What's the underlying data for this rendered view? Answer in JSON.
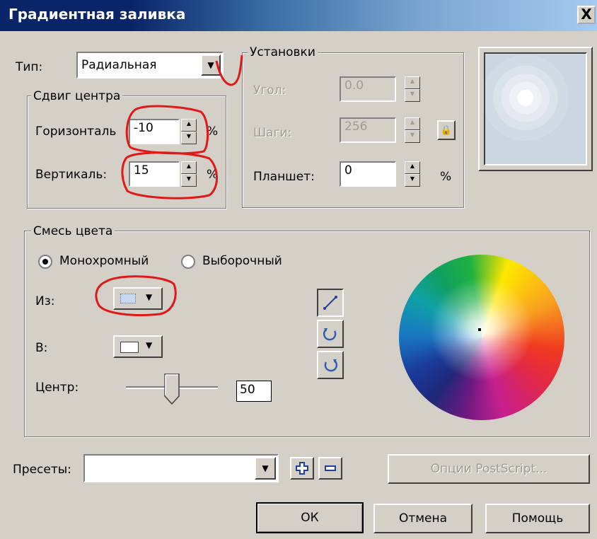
{
  "window": {
    "title": "Градиентная заливка",
    "close_label": "X"
  },
  "type_row": {
    "label": "Тип:",
    "value": "Радиальная"
  },
  "center_offset": {
    "title": "Сдвиг центра",
    "horizontal_label": "Горизонталь",
    "horizontal_value": "-10",
    "vertical_label": "Вертикаль:",
    "vertical_value": "15",
    "unit": "%"
  },
  "settings": {
    "title": "Установки",
    "angle_label": "Угол:",
    "angle_value": "0.0",
    "steps_label": "Шаги:",
    "steps_value": "256",
    "edge_pad_label": "Планшет:",
    "edge_pad_value": "0",
    "unit": "%"
  },
  "color_blend": {
    "title": "Смесь цвета",
    "mono_label": "Монохромный",
    "custom_label": "Выборочный",
    "selected": "mono",
    "from_label": "Из:",
    "to_label": "В:",
    "center_label": "Центр:",
    "center_value": "50",
    "slider_fraction": 0.5
  },
  "presets": {
    "label": "Пресеты:",
    "value": ""
  },
  "buttons": {
    "postscript": "Опции PostScript...",
    "ok": "ОК",
    "cancel": "Отмена",
    "help": "Помощь"
  },
  "colors": {
    "title_start": "#0a246a",
    "face": "#d4d0c8",
    "annotation": "#e01818",
    "from_swatch": "#c8d8f0",
    "to_swatch": "#ffffff"
  }
}
